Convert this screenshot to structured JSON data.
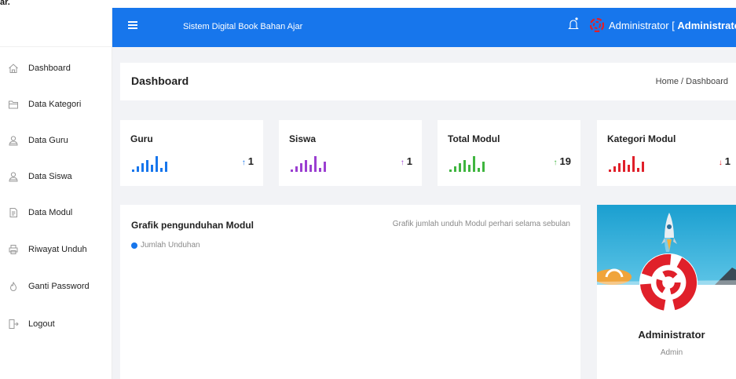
{
  "corner_text": "ar.",
  "topbar": {
    "app_title": "Sistem Digital Book Bahan Ajar",
    "user_name": "Administrator",
    "user_role_bracket": "Administrator"
  },
  "sidebar": {
    "items": [
      {
        "label": "Dashboard",
        "icon": "home-icon"
      },
      {
        "label": "Data Kategori",
        "icon": "folder-icon"
      },
      {
        "label": "Data Guru",
        "icon": "user-icon"
      },
      {
        "label": "Data Siswa",
        "icon": "user-icon"
      },
      {
        "label": "Data Modul",
        "icon": "file-icon"
      },
      {
        "label": "Riwayat Unduh",
        "icon": "printer-icon"
      },
      {
        "label": "Ganti Password",
        "icon": "flame-icon"
      },
      {
        "label": "Logout",
        "icon": "logout-icon"
      }
    ]
  },
  "header": {
    "page_title": "Dashboard",
    "breadcrumb_home": "Home",
    "breadcrumb_sep": " / ",
    "breadcrumb_current": "Dashboard"
  },
  "stats": [
    {
      "title": "Guru",
      "value": "1",
      "color": "#1776ec",
      "trend": "up"
    },
    {
      "title": "Siswa",
      "value": "1",
      "color": "#9b3fd1",
      "trend": "up"
    },
    {
      "title": "Total Modul",
      "value": "19",
      "color": "#3fb53f",
      "trend": "up"
    },
    {
      "title": "Kategori Modul",
      "value": "1",
      "color": "#e0202a",
      "trend": "down"
    }
  ],
  "chart": {
    "title": "Grafik pengunduhan Modul",
    "subtitle": "Grafik jumlah unduh Modul perhari selama sebulan",
    "legend": "Jumlah Unduhan",
    "legend_color": "#1776ec"
  },
  "profile": {
    "name": "Administrator",
    "role": "Admin"
  },
  "colors": {
    "primary": "#1776ec",
    "logo_red": "#e0202a"
  }
}
